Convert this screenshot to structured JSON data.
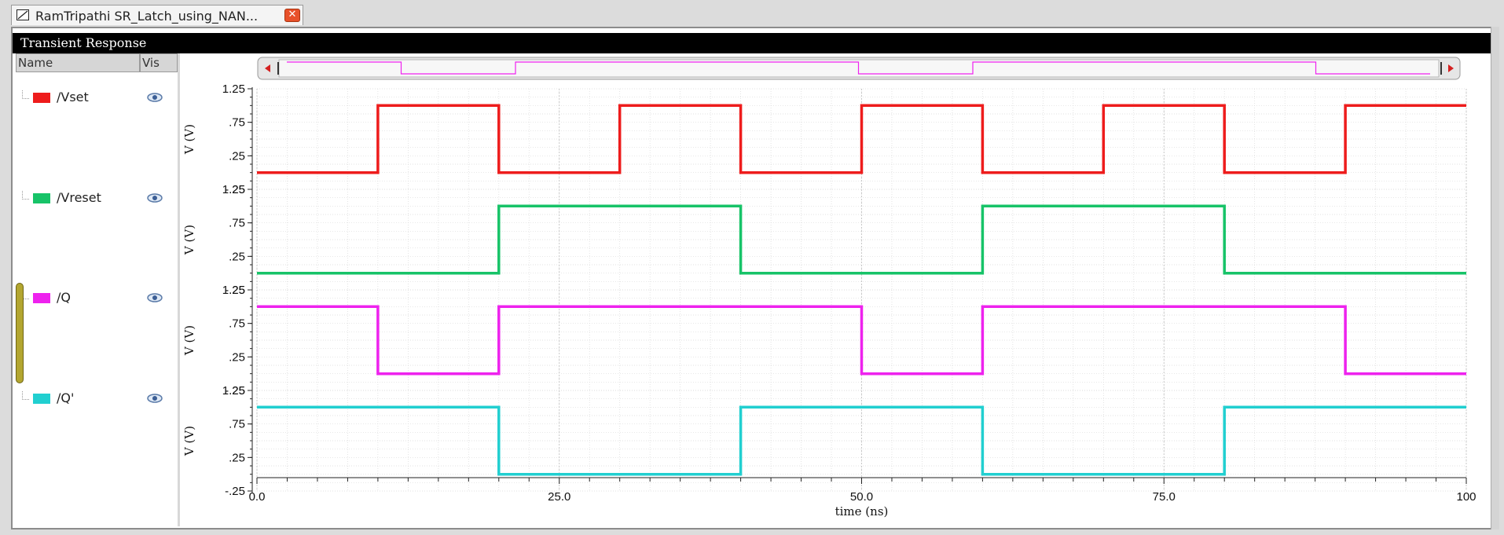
{
  "tab": {
    "title": "RamTripathi SR_Latch_using_NAN...",
    "close_icon": "close-icon"
  },
  "panel_title": "Transient Response",
  "columns": {
    "name": "Name",
    "vis": "Vis"
  },
  "signals": [
    {
      "label": "/Vset",
      "color": "#ee1c1c"
    },
    {
      "label": "/Vreset",
      "color": "#17c368"
    },
    {
      "label": "/Q",
      "color": "#ee22ee"
    },
    {
      "label": "/Q'",
      "color": "#21cfd0"
    }
  ],
  "chart_data": {
    "type": "line",
    "xlabel": "time (ns)",
    "xlim": [
      0,
      100
    ],
    "x_ticks": [
      "0.0",
      "25.0",
      "50.0",
      "75.0",
      "100"
    ],
    "ylabel": "V (V)",
    "ylim": [
      -0.25,
      1.25
    ],
    "y_ticks": [
      "1.25",
      ".75",
      ".25",
      "-.25"
    ],
    "grid": true,
    "series": [
      {
        "name": "/Vset",
        "color": "#ee1c1c",
        "x": [
          0,
          10,
          10,
          20,
          20,
          30,
          30,
          40,
          40,
          50,
          50,
          60,
          60,
          70,
          70,
          80,
          80,
          90,
          90,
          100
        ],
        "y": [
          0,
          0,
          1,
          1,
          0,
          0,
          1,
          1,
          0,
          0,
          1,
          1,
          0,
          0,
          1,
          1,
          0,
          0,
          1,
          1
        ]
      },
      {
        "name": "/Vreset",
        "color": "#17c368",
        "x": [
          0,
          20,
          20,
          40,
          40,
          60,
          60,
          80,
          80,
          100
        ],
        "y": [
          0,
          0,
          1,
          1,
          0,
          0,
          1,
          1,
          0,
          0
        ]
      },
      {
        "name": "/Q",
        "color": "#ee22ee",
        "x": [
          0,
          10,
          10,
          20,
          20,
          50,
          50,
          60,
          60,
          90,
          90,
          100
        ],
        "y": [
          1,
          1,
          0,
          0,
          1,
          1,
          0,
          0,
          1,
          1,
          0,
          0
        ]
      },
      {
        "name": "/Q'",
        "color": "#21cfd0",
        "x": [
          0,
          20,
          20,
          40,
          40,
          60,
          60,
          80,
          80,
          100
        ],
        "y": [
          1,
          1,
          0,
          0,
          1,
          1,
          0,
          0,
          1,
          1
        ]
      }
    ]
  }
}
